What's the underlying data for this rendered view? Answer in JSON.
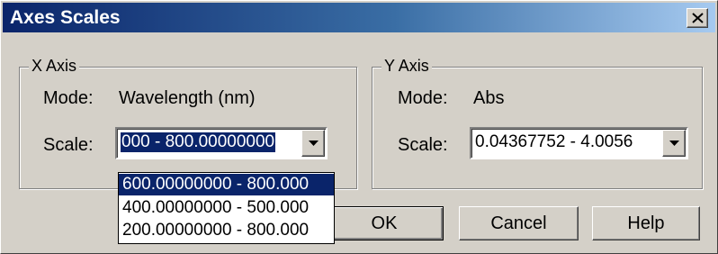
{
  "window": {
    "title": "Axes Scales",
    "close_icon": "close-icon"
  },
  "x_axis": {
    "legend": "X Axis",
    "mode_label": "Mode:",
    "mode_value": "Wavelength (nm)",
    "scale_label": "Scale:",
    "scale_value": "000 - 800.00000000",
    "options": [
      "600.00000000 - 800.000",
      "400.00000000 - 500.000",
      "200.00000000 - 800.000"
    ]
  },
  "y_axis": {
    "legend": "Y Axis",
    "mode_label": "Mode:",
    "mode_value": "Abs",
    "scale_label": "Scale:",
    "scale_value": "0.04367752 - 4.0056"
  },
  "buttons": {
    "ok": "OK",
    "cancel": "Cancel",
    "help": "Help"
  },
  "colors": {
    "title_bar": "#0a246a",
    "selection": "#0a246a",
    "face": "#d4d0c8"
  }
}
